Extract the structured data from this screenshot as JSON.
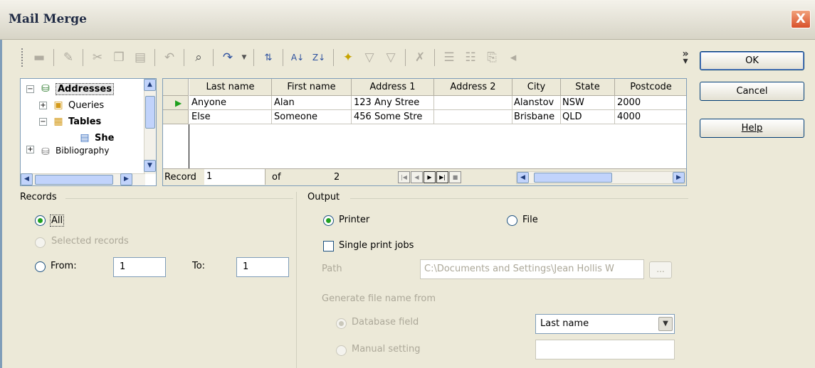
{
  "window": {
    "title": "Mail Merge",
    "close_glyph": "X"
  },
  "toolbar": {
    "icons": [
      "save-icon",
      "edit-icon",
      "cut-icon",
      "copy-icon",
      "paste-icon",
      "undo-icon",
      "find-icon",
      "redo-icon",
      "sort-ascending-icon",
      "sort-a-z-icon",
      "sort-z-a-icon",
      "autofilter-icon",
      "filter-icon",
      "standard-filter-icon",
      "remove-filter-icon",
      "data-to-text-icon",
      "data-to-fields-icon",
      "mail-merge-icon",
      "source-icon"
    ],
    "more_glyph": "»"
  },
  "tree": {
    "items": [
      {
        "label": "Addresses",
        "expander": "−",
        "bold": true
      },
      {
        "label": "Queries",
        "expander": "+",
        "bold": false
      },
      {
        "label": "Tables",
        "expander": "−",
        "bold": true
      },
      {
        "label": "She",
        "expander": "",
        "bold": true
      },
      {
        "label": "Bibliography",
        "expander": "+",
        "bold": false
      }
    ]
  },
  "grid": {
    "columns": [
      "Last name",
      "First name",
      "Address 1",
      "Address 2",
      "City",
      "State",
      "Postcode"
    ],
    "rows": [
      [
        "Anyone",
        "Alan",
        "123 Any Stree",
        "",
        "Alanstov",
        "NSW",
        "2000"
      ],
      [
        "Else",
        "Someone",
        "456 Some Stre",
        "",
        "Brisbane",
        "QLD",
        "4000"
      ]
    ],
    "footer": {
      "record_label": "Record",
      "record_value": "1",
      "of_label": "of",
      "total": "2"
    }
  },
  "buttons": {
    "ok": "OK",
    "cancel": "Cancel",
    "help": "Help"
  },
  "records": {
    "group_label": "Records",
    "all_label": "All",
    "selected_label": "Selected records",
    "from_label": "From:",
    "from_value": "1",
    "to_label": "To:",
    "to_value": "1"
  },
  "output": {
    "group_label": "Output",
    "printer_label": "Printer",
    "file_label": "File",
    "single_print_jobs_label": "Single print jobs",
    "path_label": "Path",
    "path_value": "C:\\Documents and Settings\\Jean Hollis W",
    "browse_label": "...",
    "generate_label": "Generate file name from",
    "database_field_label": "Database field",
    "database_field_value": "Last name",
    "manual_setting_label": "Manual setting",
    "manual_setting_value": ""
  },
  "colors": {
    "accent": "#21a121",
    "titlebar": "#d7d4c6",
    "close": "#d8502a"
  }
}
